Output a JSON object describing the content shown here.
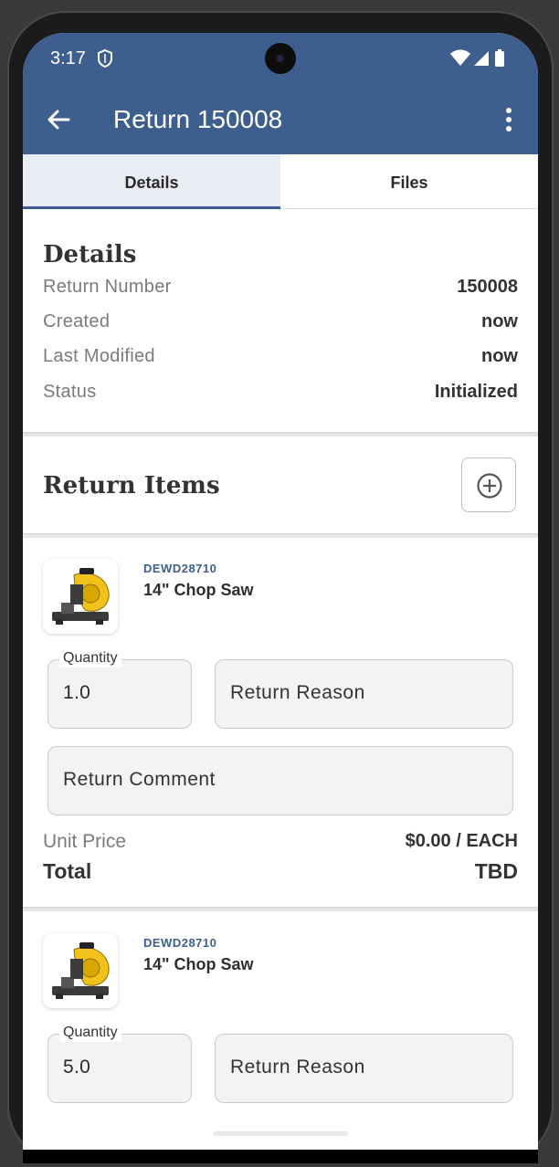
{
  "status_bar": {
    "time": "3:17"
  },
  "header": {
    "title": "Return 150008",
    "back_icon": "arrow-back-icon",
    "menu_icon": "more-vert-icon"
  },
  "tabs": [
    {
      "label": "Details",
      "selected": true
    },
    {
      "label": "Files",
      "selected": false
    }
  ],
  "details": {
    "title": "Details",
    "rows": [
      {
        "label": "Return Number",
        "value": "150008"
      },
      {
        "label": "Created",
        "value": "now"
      },
      {
        "label": "Last Modified",
        "value": "now"
      },
      {
        "label": "Status",
        "value": "Initialized"
      }
    ]
  },
  "return_items": {
    "title": "Return Items",
    "add_icon": "add-circle-icon",
    "items": [
      {
        "sku": "DEWD28710",
        "name": "14\" Chop Saw",
        "quantity_label": "Quantity",
        "quantity": "1.0",
        "reason_placeholder": "Return Reason",
        "comment_placeholder": "Return Comment",
        "unit_price_label": "Unit Price",
        "unit_price": "$0.00 / EACH",
        "total_label": "Total",
        "total": "TBD"
      },
      {
        "sku": "DEWD28710",
        "name": "14\" Chop Saw",
        "quantity_label": "Quantity",
        "quantity": "5.0",
        "reason_placeholder": "Return Reason"
      }
    ]
  },
  "colors": {
    "primary": "#3e5f8e",
    "tab_selected_bg": "#e9ecf2",
    "sku_text": "#3e5f8e"
  }
}
